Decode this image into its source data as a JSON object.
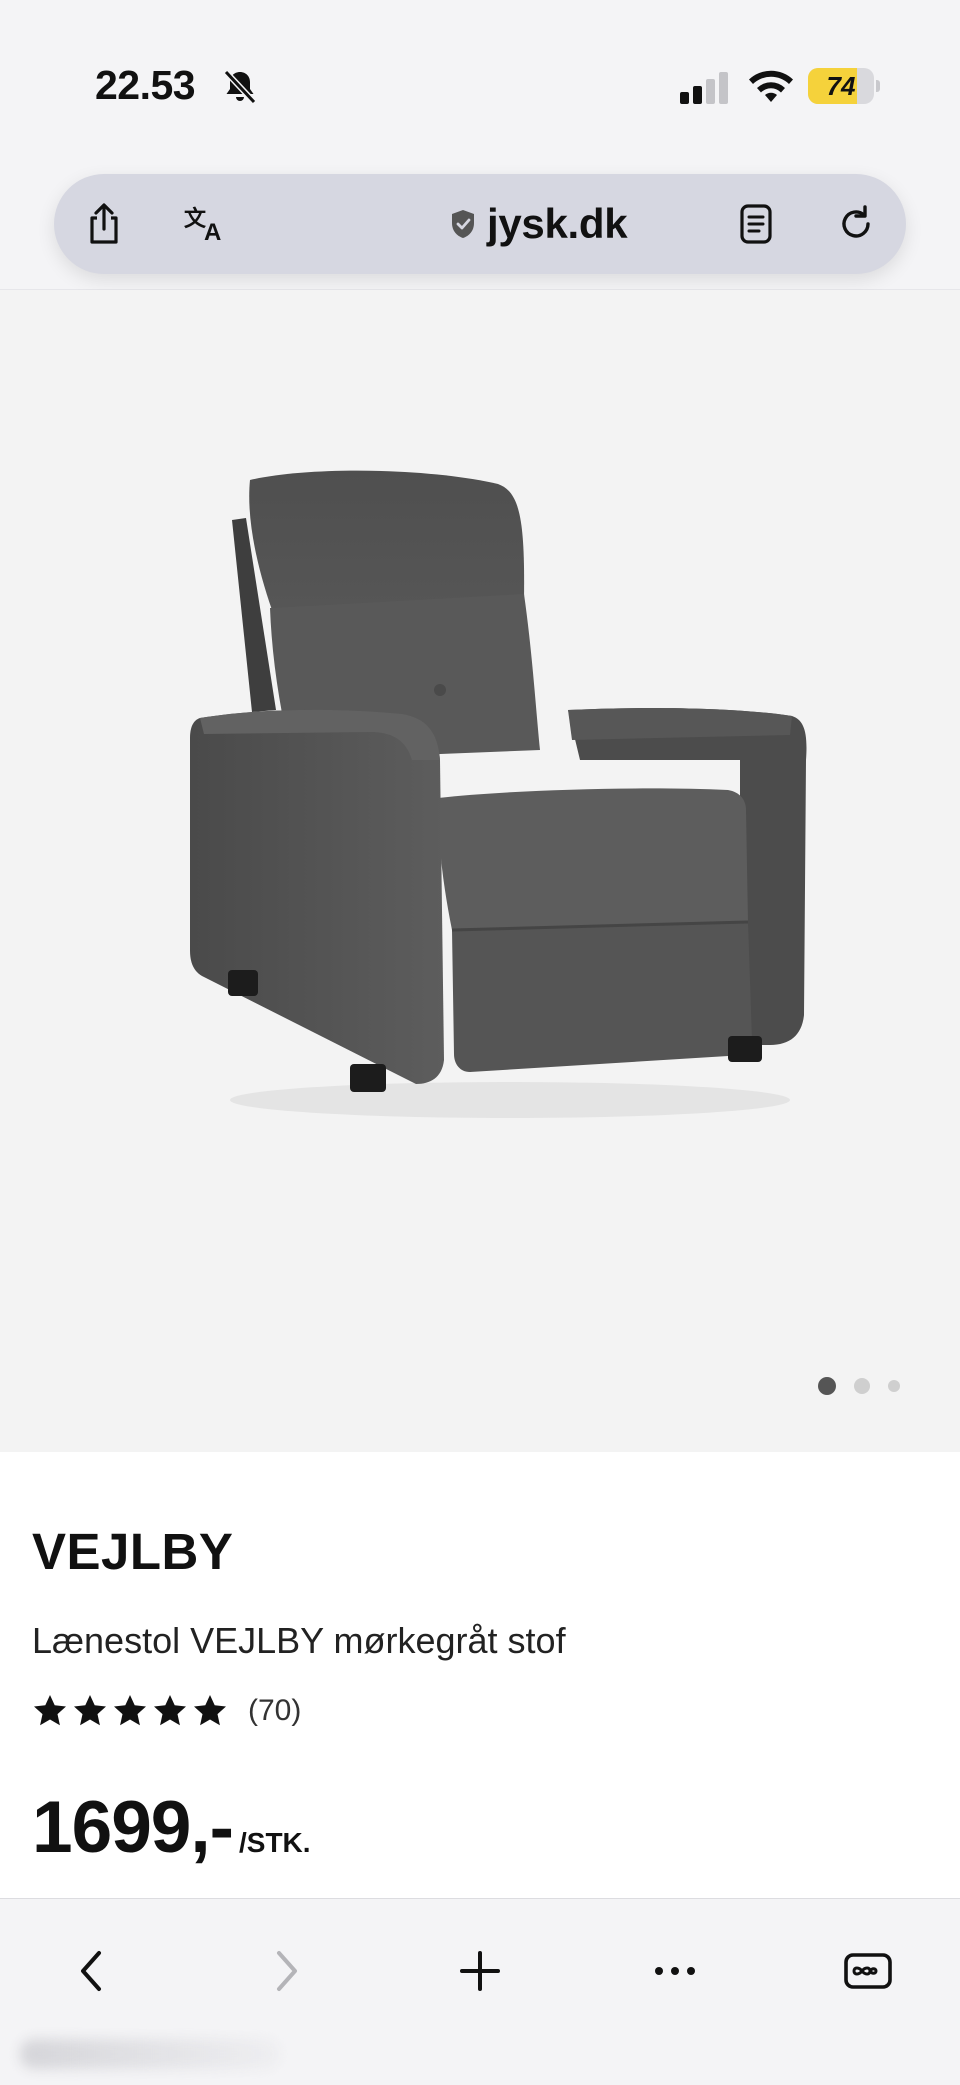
{
  "status_bar": {
    "time": "22.53",
    "battery": "74",
    "battery_level": 0.74,
    "battery_color": "#f5d23b",
    "icons": [
      "bell-slash-icon",
      "signal-icon",
      "wifi-icon",
      "battery-icon"
    ]
  },
  "browser": {
    "domain": "jysk.dk",
    "icons": [
      "share-icon",
      "translate-icon",
      "shield-icon",
      "reader-icon",
      "reload-icon"
    ],
    "bottom_icons": [
      "back-icon",
      "forward-icon",
      "new-tab-icon",
      "more-icon",
      "tabs-icon"
    ]
  },
  "gallery": {
    "image": "grey-recliner-armchair",
    "slide_count": 3,
    "active_slide": 1
  },
  "product": {
    "brand": "VEJLBY",
    "name": "Lænestol VEJLBY mørkegråt stof",
    "rating": 5,
    "review_count": "(70)",
    "price": "1699,-",
    "unit": "/STK."
  },
  "colors": {
    "chrome_bg": "#f4f4f6",
    "url_bar_bg": "#d6d7e1",
    "hero_bg": "#f3f3f3",
    "text": "#111111",
    "dot_active": "#555555",
    "dot_inactive": "#cfcfcf"
  }
}
